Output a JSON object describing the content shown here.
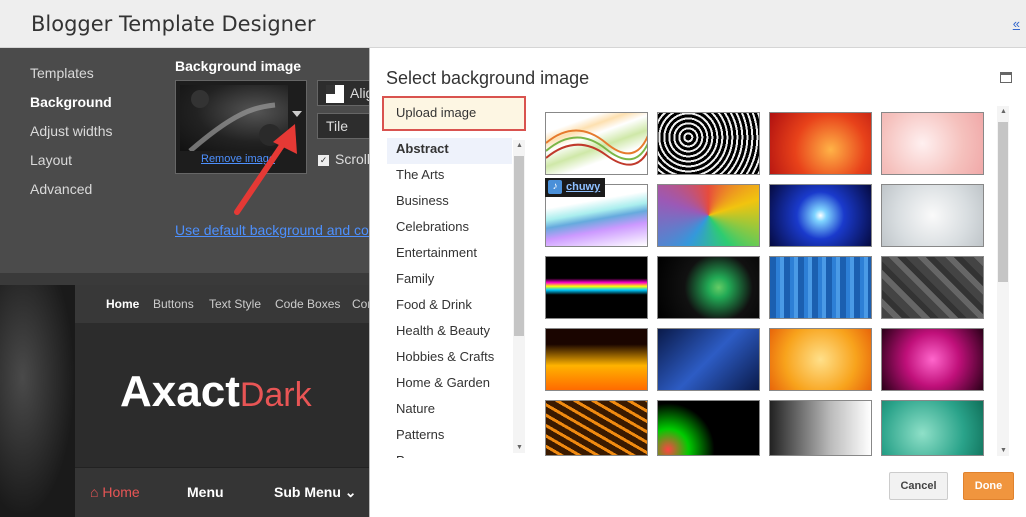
{
  "app": {
    "title": "Blogger Template Designer",
    "collapse": "«"
  },
  "sidebar": {
    "items": [
      {
        "label": "Templates"
      },
      {
        "label": "Background"
      },
      {
        "label": "Adjust widths"
      },
      {
        "label": "Layout"
      },
      {
        "label": "Advanced"
      }
    ]
  },
  "background_panel": {
    "heading": "Background image",
    "remove_link": "Remove image",
    "align_label": "Align",
    "tile_label": "Tile",
    "scroll_label": "Scroll",
    "scroll_checked": true,
    "default_link": "Use default background and colour"
  },
  "preview": {
    "nav": [
      "Home",
      "Buttons",
      "Text Style",
      "Code Boxes",
      "Con"
    ],
    "logo_main": "Axact",
    "logo_accent": "Dark",
    "menu": {
      "home": "Home",
      "menu": "Menu",
      "submenu": "Sub Menu"
    }
  },
  "dialog": {
    "title": "Select background image",
    "upload_button": "Upload image",
    "categories": [
      "Abstract",
      "The Arts",
      "Business",
      "Celebrations",
      "Entertainment",
      "Family",
      "Food & Drink",
      "Health & Beauty",
      "Hobbies & Crafts",
      "Home & Garden",
      "Nature",
      "Patterns",
      "Persons"
    ],
    "selected_category": "Abstract",
    "attribution": "chuwy",
    "cancel": "Cancel",
    "done": "Done"
  },
  "colors": {
    "accent": "#f0953e",
    "link": "#4d90fe",
    "highlight": "#d9534f",
    "logo_accent": "#e85555"
  }
}
